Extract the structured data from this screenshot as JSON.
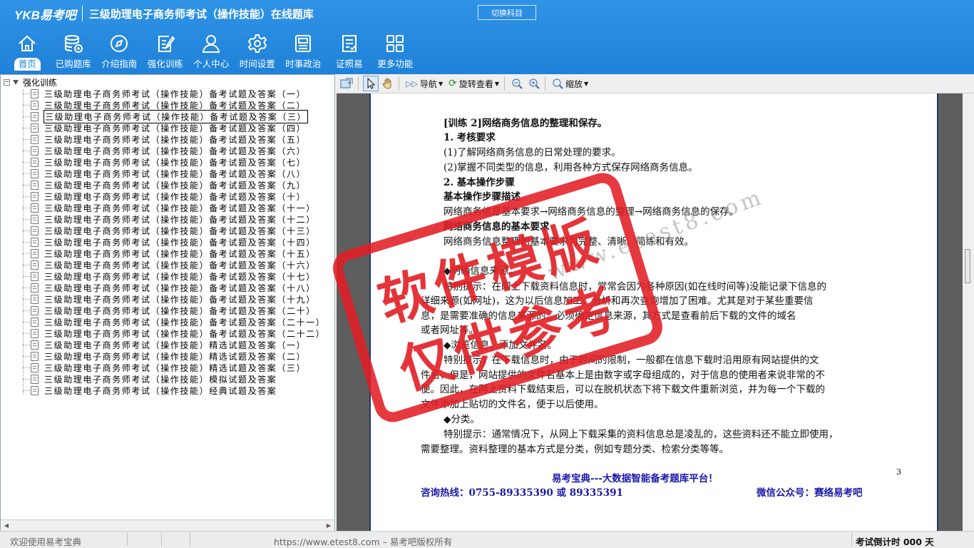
{
  "header": {
    "logo": "YKB易考吧",
    "title": "三级助理电子商务师考试（操作技能）在线题库",
    "switch_label": "切换科目"
  },
  "nav": [
    {
      "label": "首页",
      "icon": "home-icon"
    },
    {
      "label": "已购题库",
      "icon": "database-icon"
    },
    {
      "label": "介绍指南",
      "icon": "compass-icon"
    },
    {
      "label": "强化训练",
      "icon": "edit-icon"
    },
    {
      "label": "个人中心",
      "icon": "user-icon"
    },
    {
      "label": "时间设置",
      "icon": "gear-icon"
    },
    {
      "label": "时事政治",
      "icon": "news-icon"
    },
    {
      "label": "证照易",
      "icon": "checklist-icon"
    },
    {
      "label": "更多功能",
      "icon": "grid-icon"
    }
  ],
  "tree": {
    "root": "强化训练",
    "items": [
      "三级助理电子商务师考试（操作技能）备考试题及答案（一）",
      "三级助理电子商务师考试（操作技能）备考试题及答案（二）",
      "三级助理电子商务师考试（操作技能）备考试题及答案（三）",
      "三级助理电子商务师考试（操作技能）备考试题及答案（四）",
      "三级助理电子商务师考试（操作技能）备考试题及答案（五）",
      "三级助理电子商务师考试（操作技能）备考试题及答案（六）",
      "三级助理电子商务师考试（操作技能）备考试题及答案（七）",
      "三级助理电子商务师考试（操作技能）备考试题及答案（八）",
      "三级助理电子商务师考试（操作技能）备考试题及答案（九）",
      "三级助理电子商务师考试（操作技能）备考试题及答案（十）",
      "三级助理电子商务师考试（操作技能）备考试题及答案（十一）",
      "三级助理电子商务师考试（操作技能）备考试题及答案（十二）",
      "三级助理电子商务师考试（操作技能）备考试题及答案（十三）",
      "三级助理电子商务师考试（操作技能）备考试题及答案（十四）",
      "三级助理电子商务师考试（操作技能）备考试题及答案（十五）",
      "三级助理电子商务师考试（操作技能）备考试题及答案（十六）",
      "三级助理电子商务师考试（操作技能）备考试题及答案（十七）",
      "三级助理电子商务师考试（操作技能）备考试题及答案（十八）",
      "三级助理电子商务师考试（操作技能）备考试题及答案（十九）",
      "三级助理电子商务师考试（操作技能）备考试题及答案（二十）",
      "三级助理电子商务师考试（操作技能）备考试题及答案（二十一）",
      "三级助理电子商务师考试（操作技能）备考试题及答案（二十二）",
      "三级助理电子商务师考试（操作技能）精选试题及答案（一）",
      "三级助理电子商务师考试（操作技能）精选试题及答案（二）",
      "三级助理电子商务师考试（操作技能）精选试题及答案（三）",
      "三级助理电子商务师考试（操作技能）模拟试题及答案",
      "三级助理电子商务师考试（操作技能）经典试题及答案"
    ],
    "selected_index": 2
  },
  "toolbar": {
    "nav_label": "导航",
    "rotate_label": "旋转查看",
    "zoom_label": "缩放"
  },
  "document": {
    "lines": [
      "[训练 2]网络商务信息的整理和保存。",
      "1. 考核要求",
      "(1)了解网络商务信息的日常处理的要求。",
      "(2)掌握不同类型的信息，利用各种方式保存网络商务信息。",
      "2. 基本操作步骤",
      "基本操作步骤描述",
      "网络商务信息基本要求→网络商务信息的整理→网络商务信息的保存。",
      "网络商务信息的基本要求",
      "网络商务信息整理的基本要求为完整、清晰、简练和有效。",
      "◆明确信息来源。",
      "特别提示：在网上下载资料信息时，常常会因为各种原因(如在线时间等)没能记录下信息的",
      "详细来源(如网址)，这为以后信息加工、分析和再次查询增加了困难。尤其是对于某些重要信",
      "息，是需要准确的信息来源的，必须确定信息来源，其方式是查看前后下载的文件的域名",
      "或者网址等。",
      "◆浏览信息，添加文件名。",
      "特别提示：在下载信息时，由于时间的限制，一般都在信息下载时沿用原有网站提供的文",
      "件名，但是，网站提供的文件名基本上是由数字或字母组成的，对于信息的使用者来说非常的不",
      "便。因此，在网上资料下载结束后，可以在脱机状态下将下载文件重新浏览，并为每一个下载的",
      "文件添加上贴切的文件名，便于以后使用。",
      "◆分类。",
      "特别提示：通常情况下，从网上下载采集的资料信息总是凌乱的，这些资料还不能立即使用，",
      "需要整理。资料整理的基本方式是分类，例如专题分类、检索分类等等。"
    ],
    "page_number": "3",
    "footer_slogan": "易考宝典---大数据智能备考题库平台！",
    "footer_hotline": "咨询热线：0755-89335390 或 89335391",
    "footer_wechat": "微信公众号：赛络易考吧"
  },
  "stamp": {
    "line1": "软件模版",
    "line2": "仅供参考"
  },
  "watermark": "www.etest8.com",
  "status": {
    "welcome": "欢迎使用易考宝典",
    "copyright": "https://www.etest8.com – 易考吧版权所有",
    "countdown": "考试倒计时 000 天"
  },
  "colors": {
    "header_blue": "#1f82d8",
    "stamp_red": "#e21e24",
    "footer_blue": "#1a1aa8"
  }
}
